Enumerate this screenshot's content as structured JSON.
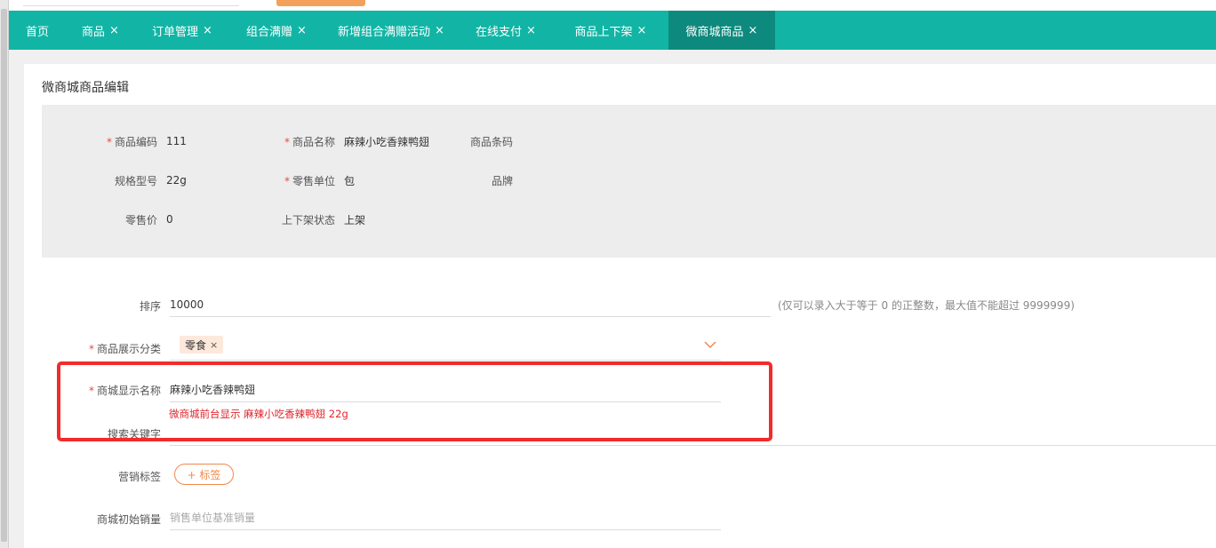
{
  "tabs": [
    {
      "label": "首页",
      "closable": false,
      "active": false
    },
    {
      "label": "商品",
      "closable": true,
      "active": false
    },
    {
      "label": "订单管理",
      "closable": true,
      "active": false
    },
    {
      "label": "组合满赠",
      "closable": true,
      "active": false
    },
    {
      "label": "新增组合满赠活动",
      "closable": true,
      "active": false
    },
    {
      "label": "在线支付",
      "closable": true,
      "active": false
    },
    {
      "label": "商品上下架",
      "closable": true,
      "active": false
    },
    {
      "label": "微商城商品",
      "closable": true,
      "active": true
    }
  ],
  "close_glyph": "×",
  "page_title": "微商城商品编辑",
  "info": {
    "code_label": "商品编码",
    "code_value": "111",
    "name_label": "商品名称",
    "name_value": "麻辣小吃香辣鸭翅",
    "barcode_label": "商品条码",
    "barcode_value": "",
    "spec_label": "规格型号",
    "spec_value": "22g",
    "unit_label": "零售单位",
    "unit_value": "包",
    "brand_label": "品牌",
    "brand_value": "",
    "price_label": "零售价",
    "price_value": "0",
    "status_label": "上下架状态",
    "status_value": "上架"
  },
  "form": {
    "sort_label": "排序",
    "sort_value": "10000",
    "sort_hint": "(仅可以录入大于等于 0 的正整数，最大值不能超过 9999999)",
    "category_label": "商品展示分类",
    "category_tag": "零食",
    "display_name_label": "商城显示名称",
    "display_name_value": "麻辣小吃香辣鸭翅",
    "display_name_note": "微商城前台显示 麻辣小吃香辣鸭翅 22g",
    "keyword_label": "搜索关键字",
    "marketing_tag_label": "营销标签",
    "add_tag_button": "+ 标签",
    "initial_sales_label": "商城初始销量",
    "initial_sales_placeholder": "销售单位基准销量"
  },
  "required_mark": "*",
  "colors": {
    "tabbar": "#12b5a5",
    "tab_active": "#0d8a7d",
    "highlight": "#f22b2b",
    "note": "#e0262d",
    "accent": "#f0894a"
  },
  "icons": {
    "dropdown": "chevron-down-icon",
    "close": "close-icon"
  }
}
